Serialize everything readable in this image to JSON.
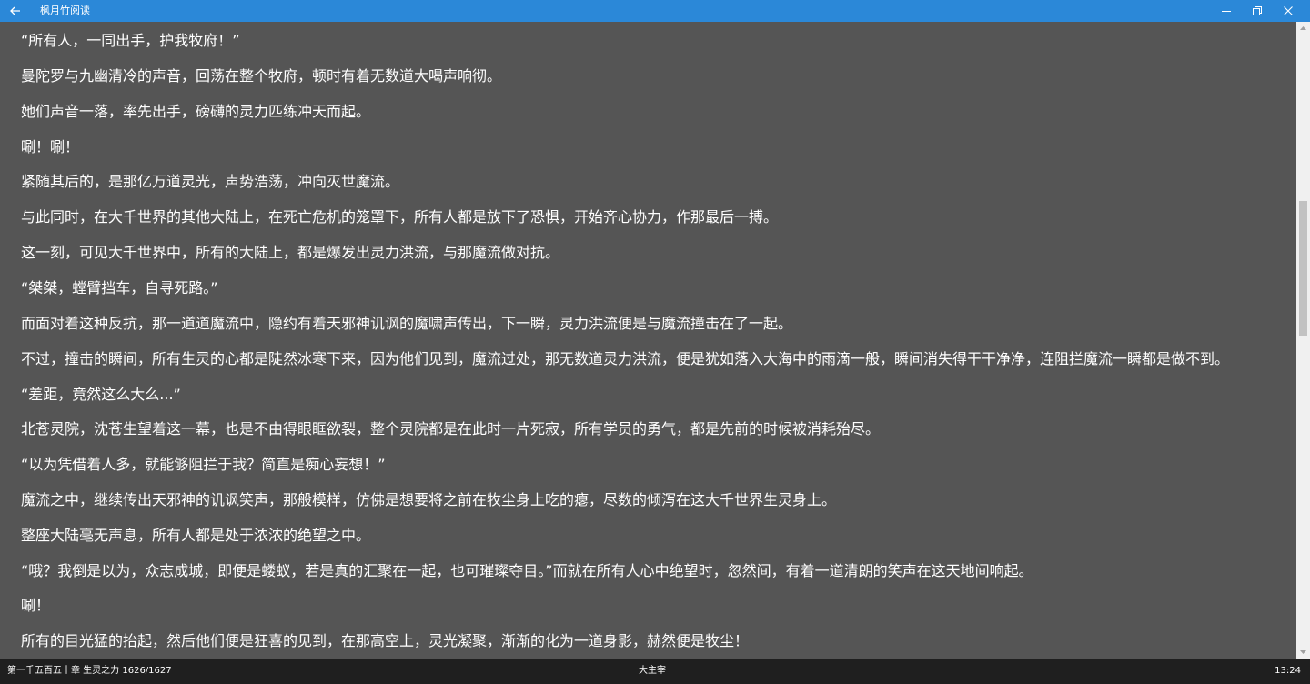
{
  "window": {
    "title": "枫月竹阅读",
    "accent_color": "#2b88d8",
    "icons": {
      "back": "arrow-left-icon",
      "minimize": "minimize-icon",
      "restore": "restore-icon",
      "close": "close-icon"
    }
  },
  "reader": {
    "background": "#555555",
    "text_color": "#ffffff",
    "paragraphs": [
      "“所有人，一同出手，护我牧府！”",
      "曼陀罗与九幽清冷的声音，回荡在整个牧府，顿时有着无数道大喝声响彻。",
      "她们声音一落，率先出手，磅礴的灵力匹练冲天而起。",
      "唰！唰！",
      "紧随其后的，是那亿万道灵光，声势浩荡，冲向灭世魔流。",
      "与此同时，在大千世界的其他大陆上，在死亡危机的笼罩下，所有人都是放下了恐惧，开始齐心协力，作那最后一搏。",
      "这一刻，可见大千世界中，所有的大陆上，都是爆发出灵力洪流，与那魔流做对抗。",
      "“桀桀，螳臂挡车，自寻死路。”",
      "而面对着这种反抗，那一道道魔流中，隐约有着天邪神讥讽的魔啸声传出，下一瞬，灵力洪流便是与魔流撞击在了一起。",
      "不过，撞击的瞬间，所有生灵的心都是陡然冰寒下来，因为他们见到，魔流过处，那无数道灵力洪流，便是犹如落入大海中的雨滴一般，瞬间消失得干干净净，连阻拦魔流一瞬都是做不到。",
      "“差距，竟然这么大么...”",
      "北苍灵院，沈苍生望着这一幕，也是不由得眼眶欲裂，整个灵院都是在此时一片死寂，所有学员的勇气，都是先前的时候被消耗殆尽。",
      "“以为凭借着人多，就能够阻拦于我？简直是痴心妄想！”",
      "魔流之中，继续传出天邪神的讥讽笑声，那般模样，仿佛是想要将之前在牧尘身上吃的瘪，尽数的倾泻在这大千世界生灵身上。",
      "整座大陆毫无声息，所有人都是处于浓浓的绝望之中。",
      "“哦？我倒是以为，众志成城，即便是蝼蚁，若是真的汇聚在一起，也可璀璨夺目。”而就在所有人心中绝望时，忽然间，有着一道清朗的笑声在这天地间响起。",
      "唰！",
      "所有的目光猛的抬起，然后他们便是狂喜的见到，在那高空上，灵光凝聚，渐渐的化为一道身影，赫然便是牧尘！"
    ]
  },
  "scrollbar": {
    "position_fraction": 0.35,
    "thumb_fraction": 0.22
  },
  "status": {
    "chapter_info": "第一千五百五十章 生灵之力 1626/1627",
    "book_title": "大主宰",
    "time": "13:24"
  }
}
